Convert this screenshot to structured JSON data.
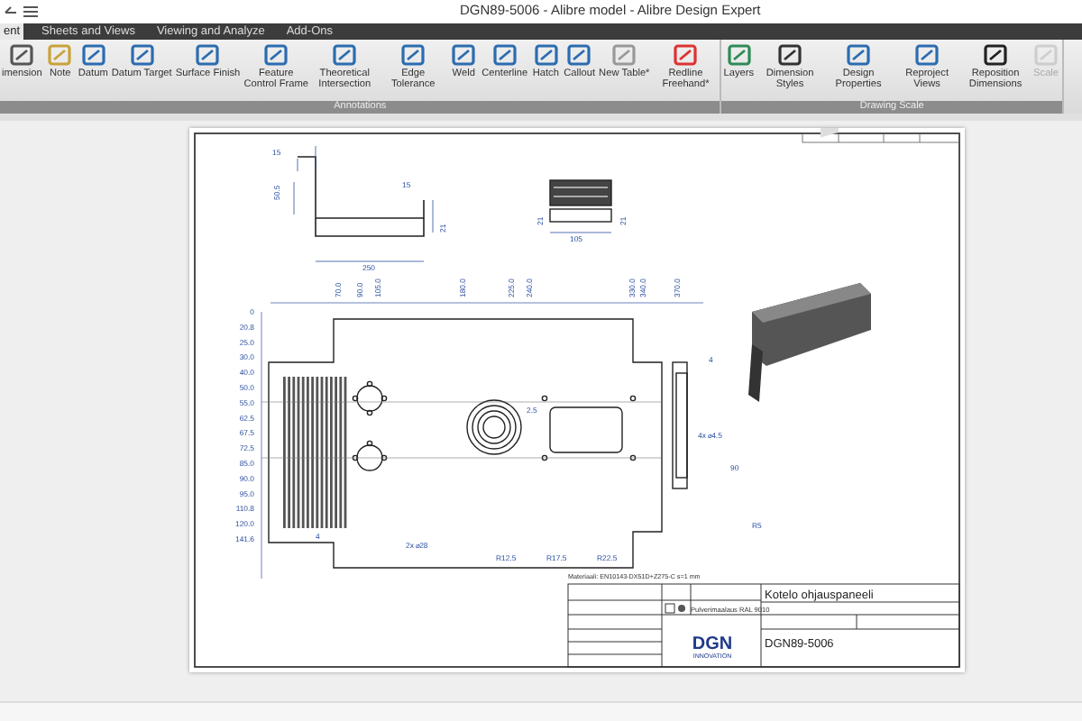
{
  "window": {
    "title": "DGN89-5006 - Alibre model - Alibre Design Expert"
  },
  "tabs": [
    {
      "label": "ent",
      "selected": true
    },
    {
      "label": "Sheets and Views",
      "selected": false
    },
    {
      "label": "Viewing and Analyze",
      "selected": false
    },
    {
      "label": "Add-Ons",
      "selected": false
    }
  ],
  "ribbon_groups": [
    {
      "label": "Annotations",
      "buttons": [
        {
          "label": "imension",
          "disabled": false
        },
        {
          "label": "Note",
          "disabled": false
        },
        {
          "label": "Datum",
          "disabled": false
        },
        {
          "label": "Datum Target",
          "disabled": false
        },
        {
          "label": "Surface Finish",
          "disabled": false
        },
        {
          "label": "Feature Control Frame",
          "disabled": false
        },
        {
          "label": "Theoretical Intersection",
          "disabled": false
        },
        {
          "label": "Edge Tolerance",
          "disabled": false
        },
        {
          "label": "Weld",
          "disabled": false
        },
        {
          "label": "Centerline",
          "disabled": false
        },
        {
          "label": "Hatch",
          "disabled": false
        },
        {
          "label": "Callout",
          "disabled": false
        },
        {
          "label": "New Table*",
          "disabled": false
        },
        {
          "label": "Redline Freehand*",
          "disabled": false
        }
      ]
    },
    {
      "label": "Drawing Scale",
      "buttons": [
        {
          "label": "Layers",
          "disabled": false
        },
        {
          "label": "Dimension Styles",
          "disabled": false
        },
        {
          "label": "Design Properties",
          "disabled": false
        },
        {
          "label": "Reproject Views",
          "disabled": false
        },
        {
          "label": "Reposition Dimensions",
          "disabled": false
        },
        {
          "label": "Scale",
          "disabled": true
        }
      ]
    }
  ],
  "sheet": {
    "side_view": {
      "labels": [
        "15",
        "50.5",
        "15",
        "250",
        "21"
      ]
    },
    "end_view": {
      "labels": [
        "21",
        "105",
        "21"
      ]
    },
    "front_view": {
      "top_dimensions": [
        "70.0",
        "90.0",
        "105.0",
        "180.0",
        "225.0",
        "240.0",
        "330.0",
        "340.0",
        "370.0"
      ],
      "left_dimensions": [
        "0",
        "20.8",
        "25.0",
        "30.0",
        "40.0",
        "50.0",
        "55.0",
        "62.5",
        "67.5",
        "72.5",
        "85.0",
        "90.0",
        "95.0",
        "110.8",
        "120.0",
        "141.6"
      ],
      "callouts": [
        "4",
        "2.5",
        "4x ⌀4.5",
        "90",
        "R5",
        "4",
        "2x ⌀28",
        "R12.5",
        "R17.5",
        "R22.5"
      ]
    },
    "material_note": "Materiaali: EN10143-DX51D+Z275-C  s=1 mm",
    "title_block": {
      "finish": "Pulverimaalaus RAL 9010",
      "title": "Kotelo ohjauspaneeli",
      "drawing_number": "DGN89-5006",
      "logo_text": "DGN",
      "logo_subtext": "INNOVATION"
    }
  }
}
